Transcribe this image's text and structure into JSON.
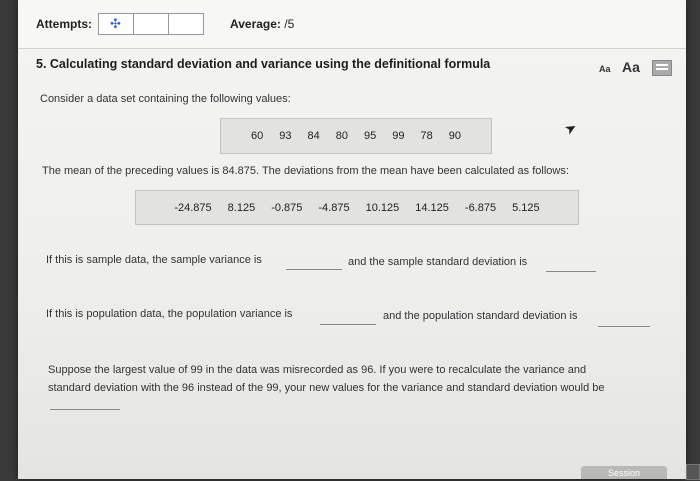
{
  "header": {
    "attempts_label": "Attempts:",
    "average_label": "Average:",
    "average_value": "/5"
  },
  "question": {
    "title": "5. Calculating standard deviation and variance using the definitional formula",
    "font_small": "Aa",
    "font_large": "Aa",
    "intro": "Consider a data set containing the following values:",
    "values": [
      "60",
      "93",
      "84",
      "80",
      "95",
      "99",
      "78",
      "90"
    ],
    "mean_text": "The mean of the preceding values is 84.875. The deviations from the mean have been calculated as follows:",
    "deviations": [
      "-24.875",
      "8.125",
      "-0.875",
      "-4.875",
      "10.125",
      "14.125",
      "-6.875",
      "5.125"
    ],
    "sample_variance_text": "If this is sample data, the sample variance is",
    "sample_sd_text": "and the sample standard deviation is",
    "population_variance_text": "If this is population data, the population variance is",
    "population_sd_text": "and the population standard deviation is",
    "recalc_text_1": "Suppose the largest value of 99 in the data was misrecorded as 96. If you were to recalculate the variance and",
    "recalc_text_2": "standard deviation with the 96 instead of the 99, your new values for the variance and standard deviation would be"
  },
  "footer": {
    "session_label": "Session"
  }
}
